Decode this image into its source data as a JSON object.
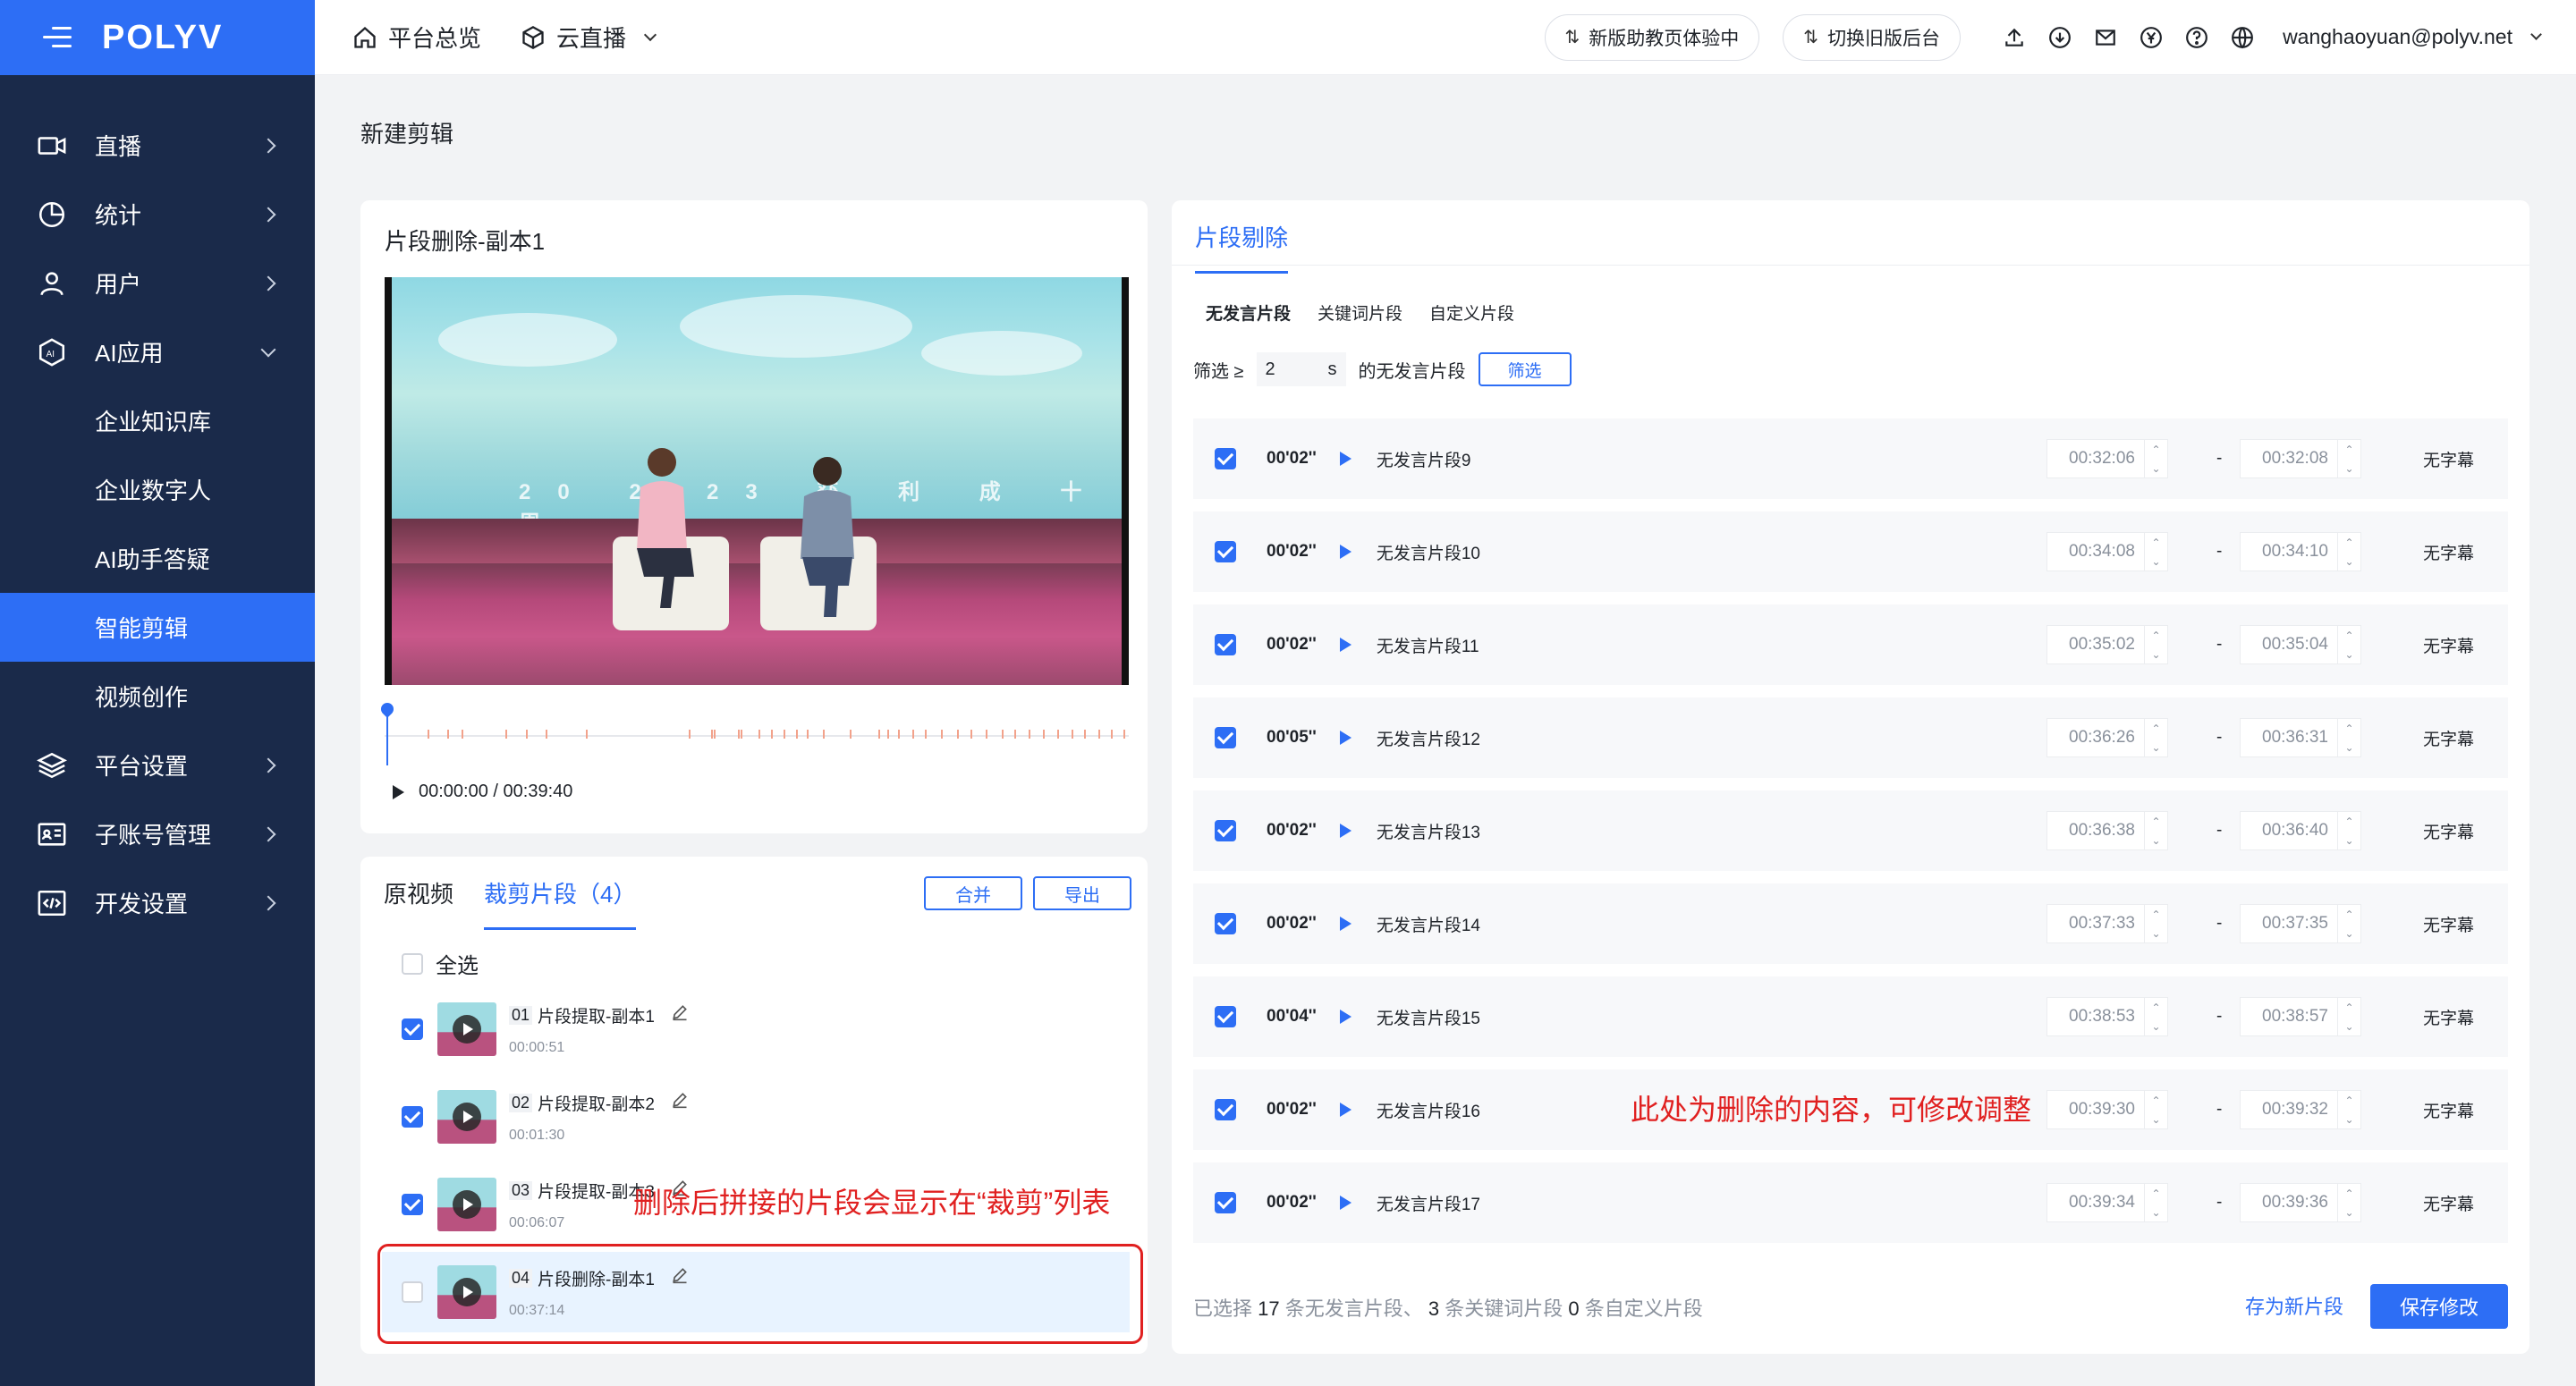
{
  "brand": {
    "logo": "POLYV"
  },
  "sidebar": {
    "items": [
      {
        "label": "直播",
        "icon": "camera-icon"
      },
      {
        "label": "统计",
        "icon": "pie-chart-icon"
      },
      {
        "label": "用户",
        "icon": "user-icon"
      },
      {
        "label": "AI应用",
        "icon": "ai-icon",
        "expanded": true
      }
    ],
    "sub_items": [
      "企业知识库",
      "企业数字人",
      "AI助手答疑",
      "智能剪辑",
      "视频创作"
    ],
    "active_sub": "智能剪辑",
    "items2": [
      {
        "label": "平台设置",
        "icon": "layers-icon"
      },
      {
        "label": "子账号管理",
        "icon": "id-card-icon"
      },
      {
        "label": "开发设置",
        "icon": "code-icon"
      }
    ]
  },
  "topbar": {
    "home": "平台总览",
    "live": "云直播",
    "new_version": "新版助教页体验中",
    "old_version": "切换旧版后台",
    "email": "wanghaoyuan@polyv.net"
  },
  "page": {
    "title": "新建剪辑"
  },
  "player": {
    "clip_title": "片段删除-副本1",
    "banner": "20  2023  获 利 成 十 周",
    "time": "00:00:00 / 00:39:40"
  },
  "clips": {
    "tab_original": "原视频",
    "tab_cut": "裁剪片段（4）",
    "merge": "合并",
    "export": "导出",
    "select_all": "全选",
    "items": [
      {
        "num": "01",
        "name": "片段提取-副本1",
        "dur": "00:00:51",
        "checked": true
      },
      {
        "num": "02",
        "name": "片段提取-副本2",
        "dur": "00:01:30",
        "checked": true
      },
      {
        "num": "03",
        "name": "片段提取-副本3",
        "dur": "00:06:07",
        "checked": true
      },
      {
        "num": "04",
        "name": "片段删除-副本1",
        "dur": "00:37:14",
        "checked": false
      }
    ],
    "annotation": "删除后拼接的片段会显示在“裁剪”列表"
  },
  "right": {
    "tab": "片段剔除",
    "subtabs": [
      "无发言片段",
      "关键词片段",
      "自定义片段"
    ],
    "filter": {
      "prefix": "筛选 ≥",
      "value": "2",
      "unit": "s",
      "suffix": "的无发言片段",
      "button": "筛选"
    },
    "rows": [
      {
        "len": "00'02''",
        "name": "无发言片段9",
        "start": "00:32:06",
        "end": "00:32:08",
        "caption": "无字幕"
      },
      {
        "len": "00'02''",
        "name": "无发言片段10",
        "start": "00:34:08",
        "end": "00:34:10",
        "caption": "无字幕"
      },
      {
        "len": "00'02''",
        "name": "无发言片段11",
        "start": "00:35:02",
        "end": "00:35:04",
        "caption": "无字幕"
      },
      {
        "len": "00'05''",
        "name": "无发言片段12",
        "start": "00:36:26",
        "end": "00:36:31",
        "caption": "无字幕"
      },
      {
        "len": "00'02''",
        "name": "无发言片段13",
        "start": "00:36:38",
        "end": "00:36:40",
        "caption": "无字幕"
      },
      {
        "len": "00'02''",
        "name": "无发言片段14",
        "start": "00:37:33",
        "end": "00:37:35",
        "caption": "无字幕"
      },
      {
        "len": "00'04''",
        "name": "无发言片段15",
        "start": "00:38:53",
        "end": "00:38:57",
        "caption": "无字幕"
      },
      {
        "len": "00'02''",
        "name": "无发言片段16",
        "start": "00:39:30",
        "end": "00:39:32",
        "caption": "无字幕"
      },
      {
        "len": "00'02''",
        "name": "无发言片段17",
        "start": "00:39:34",
        "end": "00:39:36",
        "caption": "无字幕"
      }
    ],
    "summary": {
      "p1": "已选择",
      "n1": "17",
      "p2": "条无发言片段、",
      "n2": "3",
      "p3": "条关键词片段",
      "n3": "0",
      "p4": "条自定义片段"
    },
    "save_new": "存为新片段",
    "save": "保存修改",
    "annotation": "此处为删除的内容，可修改调整"
  },
  "colors": {
    "primary": "#2d6ef5",
    "sidebar": "#1a2a4a",
    "annotation": "#e02020"
  }
}
